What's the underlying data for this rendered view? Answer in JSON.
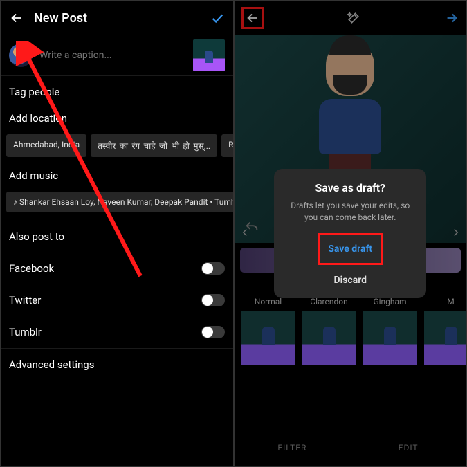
{
  "left": {
    "title": "New Post",
    "caption_placeholder": "Write a caption...",
    "tag_people": "Tag people",
    "add_location": "Add location",
    "location_chips": [
      "Ahmedabad, India",
      "तस्वीर_का_रंग_चाहे_जो_भी_हो_मुस्...",
      "River Front A"
    ],
    "add_music": "Add music",
    "music_chip": "♪ Shankar Ehsaan Loy, Naveen Kumar, Deepak Pandit • Tumhi Dekho N...",
    "also_post": "Also post to",
    "toggles": [
      {
        "label": "Facebook"
      },
      {
        "label": "Twitter"
      },
      {
        "label": "Tumblr"
      }
    ],
    "advanced": "Advanced settings"
  },
  "right": {
    "filters": [
      "Normal",
      "Clarendon",
      "Gingham",
      "M"
    ],
    "tabs": {
      "filter": "FILTER",
      "edit": "EDIT"
    },
    "modal": {
      "title": "Save as draft?",
      "description": "Drafts let you save your edits, so you can come back later.",
      "save": "Save draft",
      "discard": "Discard"
    }
  }
}
